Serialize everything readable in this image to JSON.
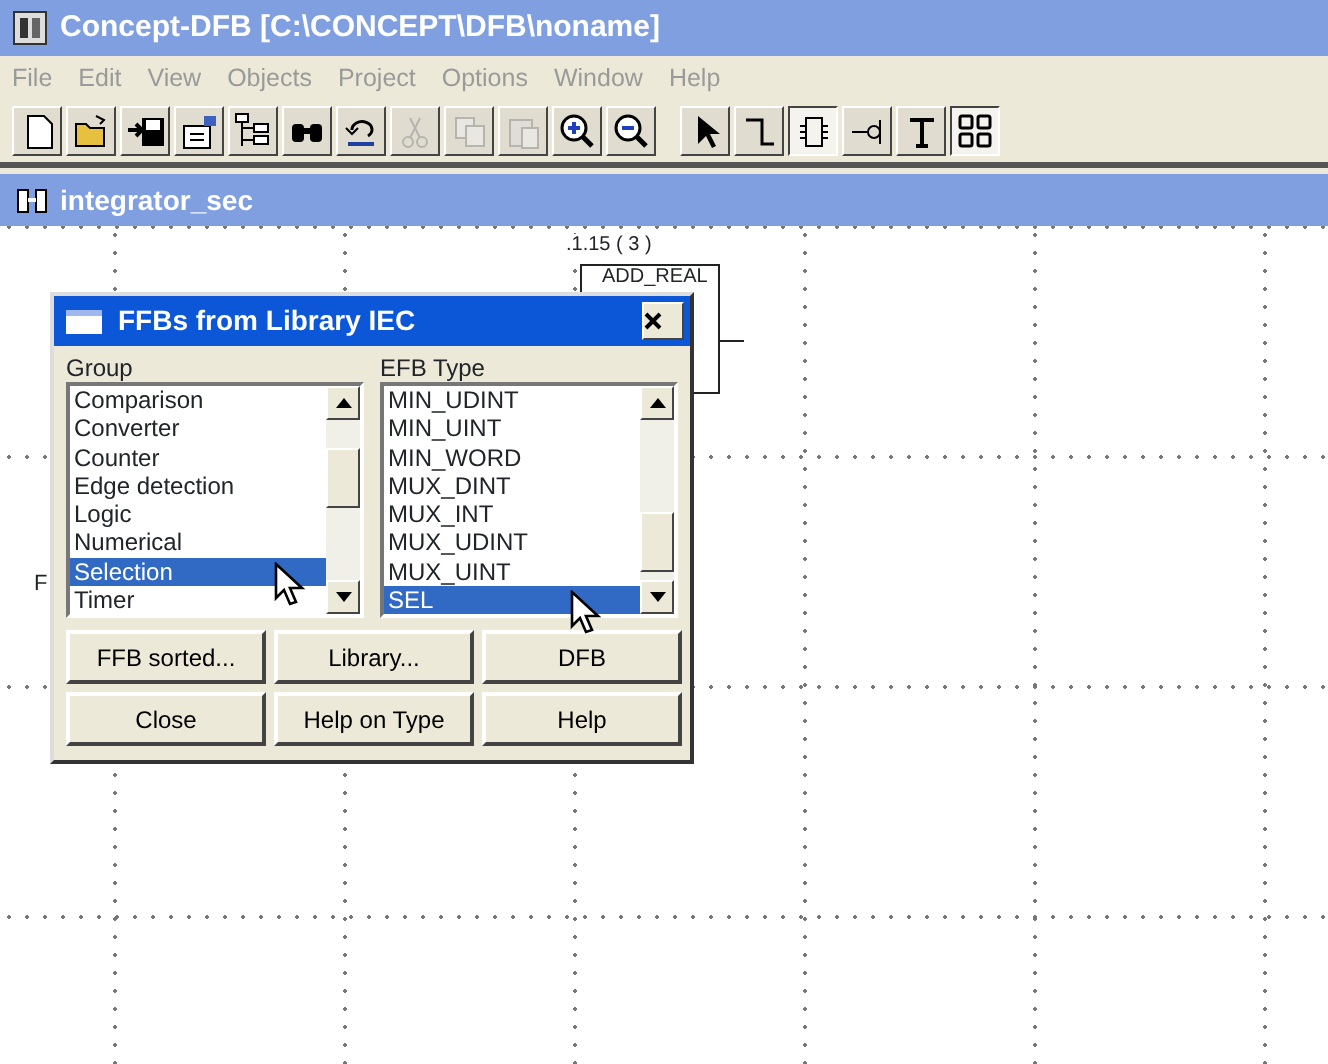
{
  "window": {
    "title": "Concept-DFB [C:\\CONCEPT\\DFB\\noname]"
  },
  "menu": [
    "File",
    "Edit",
    "View",
    "Objects",
    "Project",
    "Options",
    "Window",
    "Help"
  ],
  "toolbar": [
    {
      "kind": "button",
      "pressed": false,
      "disabled": false
    },
    {
      "kind": "button",
      "pressed": false,
      "disabled": false
    },
    {
      "kind": "button",
      "pressed": false,
      "disabled": false
    },
    {
      "kind": "button",
      "pressed": false,
      "disabled": false
    },
    {
      "kind": "button",
      "pressed": false,
      "disabled": false
    },
    {
      "kind": "button",
      "pressed": false,
      "disabled": false
    },
    {
      "kind": "button",
      "pressed": false,
      "disabled": false
    },
    {
      "kind": "button",
      "pressed": false,
      "disabled": true
    },
    {
      "kind": "button",
      "pressed": false,
      "disabled": true
    },
    {
      "kind": "button",
      "pressed": false,
      "disabled": true
    },
    {
      "kind": "button",
      "pressed": false,
      "disabled": false
    },
    {
      "kind": "button",
      "pressed": false,
      "disabled": false
    },
    {
      "kind": "separator"
    },
    {
      "kind": "button",
      "pressed": false,
      "disabled": false
    },
    {
      "kind": "button",
      "pressed": false,
      "disabled": false
    },
    {
      "kind": "button",
      "pressed": true,
      "disabled": false
    },
    {
      "kind": "button",
      "pressed": false,
      "disabled": false
    },
    {
      "kind": "button",
      "pressed": false,
      "disabled": false
    },
    {
      "kind": "button",
      "pressed": true,
      "disabled": false
    }
  ],
  "document": {
    "title": "integrator_sec",
    "block_ref": ".1.15 ( 3 )",
    "block_name": "ADD_REAL",
    "partial_label": "F"
  },
  "dialog": {
    "title": "FFBs from Library IEC",
    "group": {
      "label": "Group",
      "items": [
        {
          "text": "Comparison",
          "selected": false
        },
        {
          "text": "Converter",
          "selected": false
        },
        {
          "text": "Counter",
          "selected": false
        },
        {
          "text": "Edge detection",
          "selected": false
        },
        {
          "text": "Logic",
          "selected": false
        },
        {
          "text": "Numerical",
          "selected": false
        },
        {
          "text": "Selection",
          "selected": true
        },
        {
          "text": "Timer",
          "selected": false
        }
      ]
    },
    "efb_type": {
      "label": "EFB Type",
      "items": [
        {
          "text": "MIN_UDINT",
          "selected": false
        },
        {
          "text": "MIN_UINT",
          "selected": false
        },
        {
          "text": "MIN_WORD",
          "selected": false
        },
        {
          "text": "MUX_DINT",
          "selected": false
        },
        {
          "text": "MUX_INT",
          "selected": false
        },
        {
          "text": "MUX_UDINT",
          "selected": false
        },
        {
          "text": "MUX_UINT",
          "selected": false
        },
        {
          "text": "SEL",
          "selected": true
        }
      ]
    },
    "buttons": [
      "FFB sorted...",
      "Library...",
      "DFB",
      "Close",
      "Help on Type",
      "Help"
    ]
  }
}
